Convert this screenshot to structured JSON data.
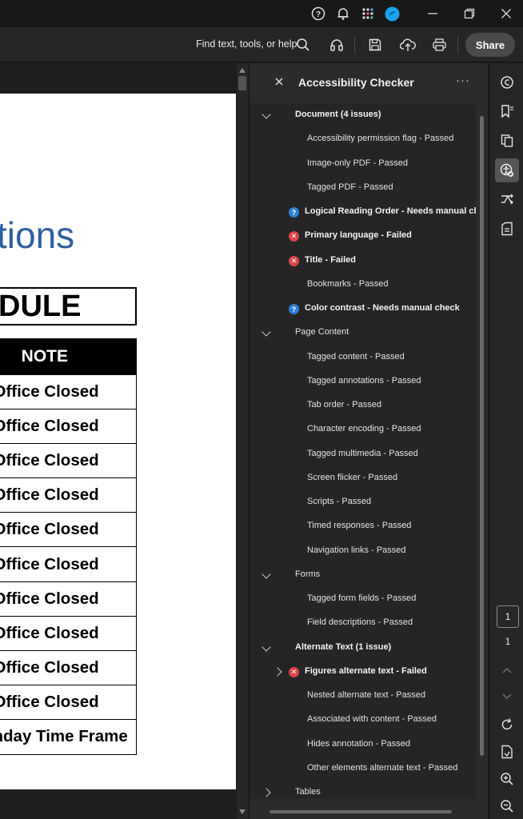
{
  "titlebar": {
    "icons": [
      "help-icon",
      "bell-icon",
      "apps-grid-icon",
      "profile-avatar-icon"
    ],
    "window_controls": [
      "minimize-icon",
      "restore-icon",
      "close-icon"
    ]
  },
  "toolbar": {
    "find_label": "Find text, tools, or help",
    "share_label": "Share",
    "icons": [
      "search-icon",
      "headphones-icon",
      "save-icon",
      "cloud-upload-icon",
      "print-icon"
    ]
  },
  "document": {
    "heading_fragment": "tions",
    "schedule_fragment": "DULE",
    "note_header": "NOTE",
    "rows": [
      "Office Closed",
      "Office Closed",
      "Office Closed",
      "Office Closed",
      "Office Closed",
      "Office Closed",
      "Office Closed",
      "Office Closed",
      "Office Closed",
      "Office Closed",
      "nday Time Frame"
    ]
  },
  "panel": {
    "title": "Accessibility Checker",
    "more_label": "···",
    "items": [
      {
        "text": "Document (4 issues)",
        "level": 0,
        "expand": "down",
        "bold": true,
        "status": ""
      },
      {
        "text": "Accessibility permission flag - Passed",
        "level": 1,
        "expand": "",
        "bold": false,
        "status": ""
      },
      {
        "text": "Image-only PDF - Passed",
        "level": 1,
        "expand": "",
        "bold": false,
        "status": ""
      },
      {
        "text": "Tagged PDF - Passed",
        "level": 1,
        "expand": "",
        "bold": false,
        "status": ""
      },
      {
        "text": "Logical Reading Order - Needs manual check",
        "level": 1,
        "expand": "",
        "bold": true,
        "status": "manual"
      },
      {
        "text": "Primary language - Failed",
        "level": 1,
        "expand": "",
        "bold": true,
        "status": "failed"
      },
      {
        "text": "Title - Failed",
        "level": 1,
        "expand": "",
        "bold": true,
        "status": "failed"
      },
      {
        "text": "Bookmarks - Passed",
        "level": 1,
        "expand": "",
        "bold": false,
        "status": ""
      },
      {
        "text": "Color contrast - Needs manual check",
        "level": 1,
        "expand": "",
        "bold": true,
        "status": "manual"
      },
      {
        "text": "Page Content",
        "level": 0,
        "expand": "down",
        "bold": false,
        "status": ""
      },
      {
        "text": "Tagged content - Passed",
        "level": 1,
        "expand": "",
        "bold": false,
        "status": ""
      },
      {
        "text": "Tagged annotations - Passed",
        "level": 1,
        "expand": "",
        "bold": false,
        "status": ""
      },
      {
        "text": "Tab order - Passed",
        "level": 1,
        "expand": "",
        "bold": false,
        "status": ""
      },
      {
        "text": "Character encoding - Passed",
        "level": 1,
        "expand": "",
        "bold": false,
        "status": ""
      },
      {
        "text": "Tagged multimedia - Passed",
        "level": 1,
        "expand": "",
        "bold": false,
        "status": ""
      },
      {
        "text": "Screen flicker - Passed",
        "level": 1,
        "expand": "",
        "bold": false,
        "status": ""
      },
      {
        "text": "Scripts - Passed",
        "level": 1,
        "expand": "",
        "bold": false,
        "status": ""
      },
      {
        "text": "Timed responses - Passed",
        "level": 1,
        "expand": "",
        "bold": false,
        "status": ""
      },
      {
        "text": "Navigation links - Passed",
        "level": 1,
        "expand": "",
        "bold": false,
        "status": ""
      },
      {
        "text": "Forms",
        "level": 0,
        "expand": "down",
        "bold": false,
        "status": ""
      },
      {
        "text": "Tagged form fields - Passed",
        "level": 1,
        "expand": "",
        "bold": false,
        "status": ""
      },
      {
        "text": "Field descriptions - Passed",
        "level": 1,
        "expand": "",
        "bold": false,
        "status": ""
      },
      {
        "text": "Alternate Text (1 issue)",
        "level": 0,
        "expand": "down",
        "bold": true,
        "status": ""
      },
      {
        "text": "Figures alternate text - Failed",
        "level": 1,
        "expand": "right",
        "bold": true,
        "status": "failed"
      },
      {
        "text": "Nested alternate text - Passed",
        "level": 1,
        "expand": "",
        "bold": false,
        "status": ""
      },
      {
        "text": "Associated with content - Passed",
        "level": 1,
        "expand": "",
        "bold": false,
        "status": ""
      },
      {
        "text": "Hides annotation - Passed",
        "level": 1,
        "expand": "",
        "bold": false,
        "status": ""
      },
      {
        "text": "Other elements alternate text - Passed",
        "level": 1,
        "expand": "",
        "bold": false,
        "status": ""
      },
      {
        "text": "Tables",
        "level": 0,
        "expand": "right",
        "bold": false,
        "status": ""
      }
    ]
  },
  "rail": {
    "icons": [
      "comment-icon",
      "bookmarks-icon",
      "pages-icon",
      "accessibility-icon",
      "compare-icon",
      "document-info-icon"
    ],
    "current_page": "1",
    "total_pages": "1",
    "bottom_icons": [
      "rotate-icon",
      "extract-page-icon",
      "zoom-in-icon",
      "zoom-out-icon"
    ]
  },
  "colors": {
    "heading_blue": "#2e5f9e",
    "failed_red": "#d74648",
    "manual_blue": "#2d7fd6",
    "app_bg": "#1e1e1e"
  }
}
